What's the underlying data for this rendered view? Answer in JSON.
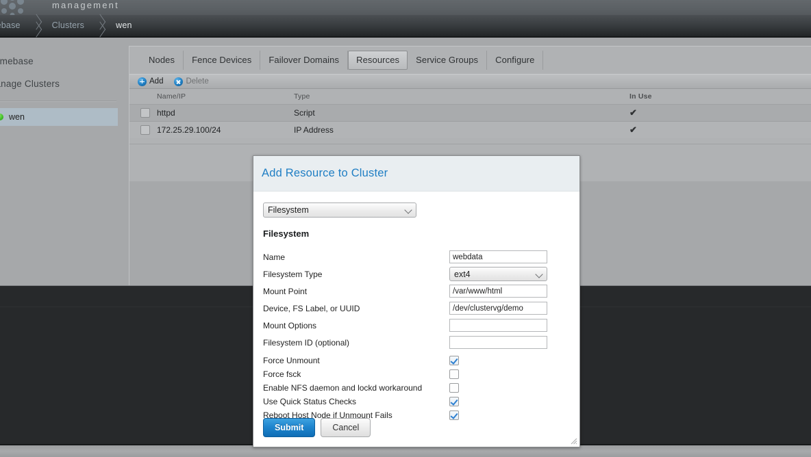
{
  "header": {
    "brand_title": "management",
    "logo_icon": "hexagon-cluster-logo"
  },
  "breadcrumb": {
    "items": [
      {
        "label": "mebase",
        "current": false
      },
      {
        "label": "Clusters",
        "current": false
      },
      {
        "label": "wen",
        "current": true
      }
    ]
  },
  "sidebar": {
    "links": [
      {
        "label": "Homebase"
      },
      {
        "label": "Manage Clusters"
      }
    ],
    "cluster": {
      "label": "wen",
      "status_icon": "green-status-dot",
      "status_color": "#3fbd27"
    }
  },
  "tabs": [
    {
      "label": "Nodes",
      "active": false
    },
    {
      "label": "Fence Devices",
      "active": false
    },
    {
      "label": "Failover Domains",
      "active": false
    },
    {
      "label": "Resources",
      "active": true
    },
    {
      "label": "Service Groups",
      "active": false
    },
    {
      "label": "Configure",
      "active": false
    }
  ],
  "toolbar": {
    "add_label": "Add",
    "add_icon": "plus-circle-icon",
    "delete_label": "Delete",
    "delete_icon": "cross-circle-icon"
  },
  "resources_table": {
    "columns": [
      "Name/IP",
      "Type",
      "In Use"
    ],
    "rows": [
      {
        "name": "httpd",
        "type": "Script",
        "in_use": "✔",
        "checked": false
      },
      {
        "name": "172.25.29.100/24",
        "type": "IP Address",
        "in_use": "✔",
        "checked": false
      }
    ]
  },
  "dialog": {
    "title": "Add Resource to Cluster",
    "resource_type_selected": "Filesystem",
    "resource_type_options": [
      "Filesystem"
    ],
    "section_title": "Filesystem",
    "fields": [
      {
        "label": "Name",
        "value": "webdata",
        "kind": "text"
      },
      {
        "label": "Filesystem Type",
        "value": "ext4",
        "kind": "select"
      },
      {
        "label": "Mount Point",
        "value": "/var/www/html",
        "kind": "text"
      },
      {
        "label": "Device, FS Label, or UUID",
        "value": "/dev/clustervg/demo",
        "kind": "text"
      },
      {
        "label": "Mount Options",
        "value": "",
        "kind": "text"
      },
      {
        "label": "Filesystem ID (optional)",
        "value": "",
        "kind": "text"
      }
    ],
    "checkboxes": [
      {
        "label": "Force Unmount",
        "checked": true
      },
      {
        "label": "Force fsck",
        "checked": false
      },
      {
        "label": "Enable NFS daemon and lockd workaround",
        "checked": false
      },
      {
        "label": "Use Quick Status Checks",
        "checked": true
      },
      {
        "label": "Reboot Host Node if Unmount Fails",
        "checked": true
      }
    ],
    "submit_label": "Submit",
    "cancel_label": "Cancel",
    "resize_icon": "resize-grip-icon",
    "accent_color": "#1f7ec4"
  }
}
